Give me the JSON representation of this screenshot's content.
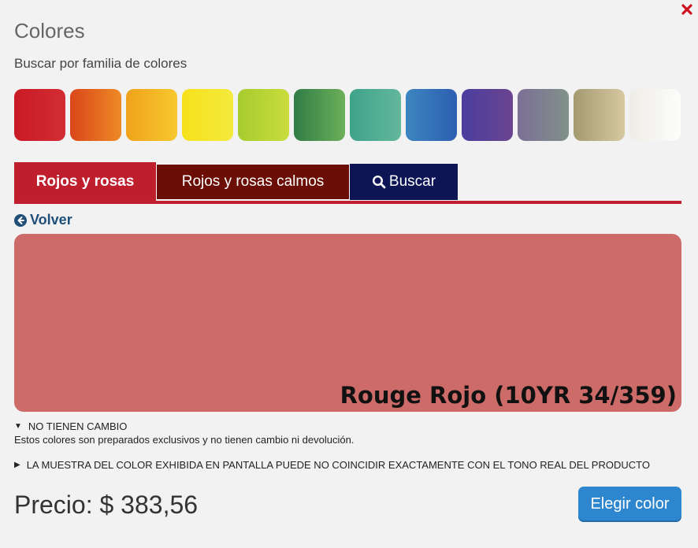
{
  "dialog": {
    "title": "Colores",
    "close_icon": "close-icon",
    "subtitle": "Buscar por familia de colores"
  },
  "families": [
    {
      "name": "rojos",
      "from": "#c81a25",
      "to": "#d32d33"
    },
    {
      "name": "naranjas",
      "from": "#d9461a",
      "to": "#ee8a25"
    },
    {
      "name": "amarillos-oscuros",
      "from": "#efa21a",
      "to": "#f7c82f"
    },
    {
      "name": "amarillos",
      "from": "#f6e11b",
      "to": "#f4ea3c"
    },
    {
      "name": "verdes-lima",
      "from": "#a7cc2f",
      "to": "#c9dc3c"
    },
    {
      "name": "verdes",
      "from": "#2f7c45",
      "to": "#6db05a"
    },
    {
      "name": "verdes-azulados",
      "from": "#3ea38a",
      "to": "#63b79b"
    },
    {
      "name": "azules",
      "from": "#3d86c0",
      "to": "#2c5eb0"
    },
    {
      "name": "violetas",
      "from": "#4a3d9e",
      "to": "#6b4591"
    },
    {
      "name": "grises",
      "from": "#7c6f97",
      "to": "#819189"
    },
    {
      "name": "neutros",
      "from": "#a49a70",
      "to": "#d6c9a2"
    },
    {
      "name": "blancos",
      "from": "#eeece6",
      "to": "#fdfdfb"
    }
  ],
  "tabs": [
    {
      "label": "Rojos y rosas"
    },
    {
      "label": "Rojos y rosas calmos"
    },
    {
      "label": "Buscar"
    }
  ],
  "back_label": "Volver",
  "preview": {
    "color": "#cd6b69",
    "name": "Rouge Rojo (10YR 34/359)"
  },
  "notes": {
    "no_change_title": "NO TIENEN CAMBIO",
    "no_change_body": "Estos colores son preparados exclusivos y no tienen cambio ni devolución.",
    "disclaimer": "LA MUESTRA DEL COLOR EXHIBIDA EN PANTALLA PUEDE NO COINCIDIR EXACTAMENTE CON EL TONO REAL DEL PRODUCTO"
  },
  "price": "Precio: $ 383,56",
  "choose_label": "Elegir color"
}
